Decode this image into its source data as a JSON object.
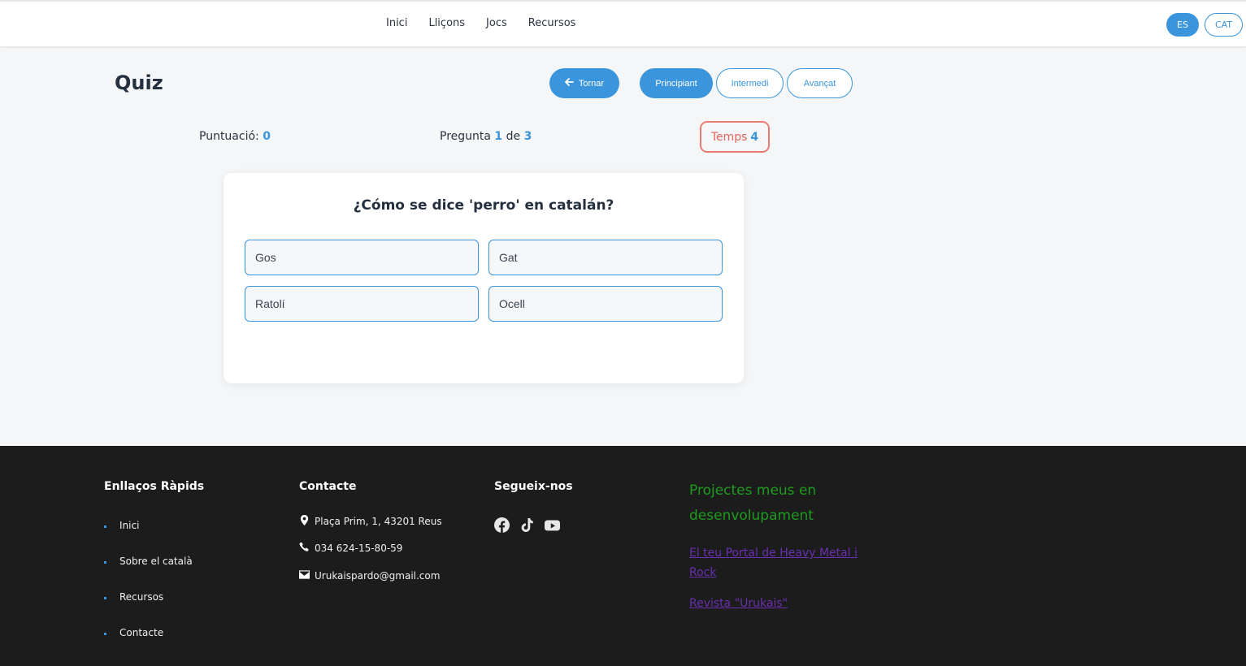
{
  "header": {
    "nav": [
      "Inici",
      "Lliçons",
      "Jocs",
      "Recursos"
    ],
    "lang_es": "ES",
    "lang_cat": "CAT"
  },
  "quiz": {
    "title": "Quiz",
    "back_label": "Tornar",
    "levels": [
      "Principiant",
      "Intermedi",
      "Avançat"
    ],
    "active_level": "Principiant",
    "score_label": "Puntuació:",
    "score": "0",
    "question_label": "Pregunta",
    "question_current": "1",
    "question_of": "de",
    "question_total": "3",
    "timer_label": "Temps",
    "timer_value": "4",
    "question_text": "¿Cómo se dice 'perro' en catalán?",
    "options": [
      "Gos",
      "Gat",
      "Ratolí",
      "Ocell"
    ]
  },
  "footer": {
    "quick_links_title": "Enllaços Ràpids",
    "quick_links": [
      "Inici",
      "Sobre el català",
      "Recursos",
      "Contacte"
    ],
    "contact_title": "Contacte",
    "address": "Plaça Prim, 1, 43201 Reus",
    "phone": "034 624-15-80-59",
    "email": "Urukaispardo@gmail.com",
    "follow_title": "Segueix-nos",
    "social_icons": [
      "facebook-icon",
      "tiktok-icon",
      "youtube-icon"
    ],
    "projects_title": "Projectes meus en desenvolupament",
    "project_links": [
      "El teu Portal de Heavy Metal i Rock",
      "Revista \"Urukais\""
    ]
  },
  "colors": {
    "accent": "#3a95dc",
    "timer_border": "#e97c72",
    "footer_bg": "#1c1c1c",
    "projects_title": "#1e9c1e",
    "project_link": "#6a2fb0"
  }
}
